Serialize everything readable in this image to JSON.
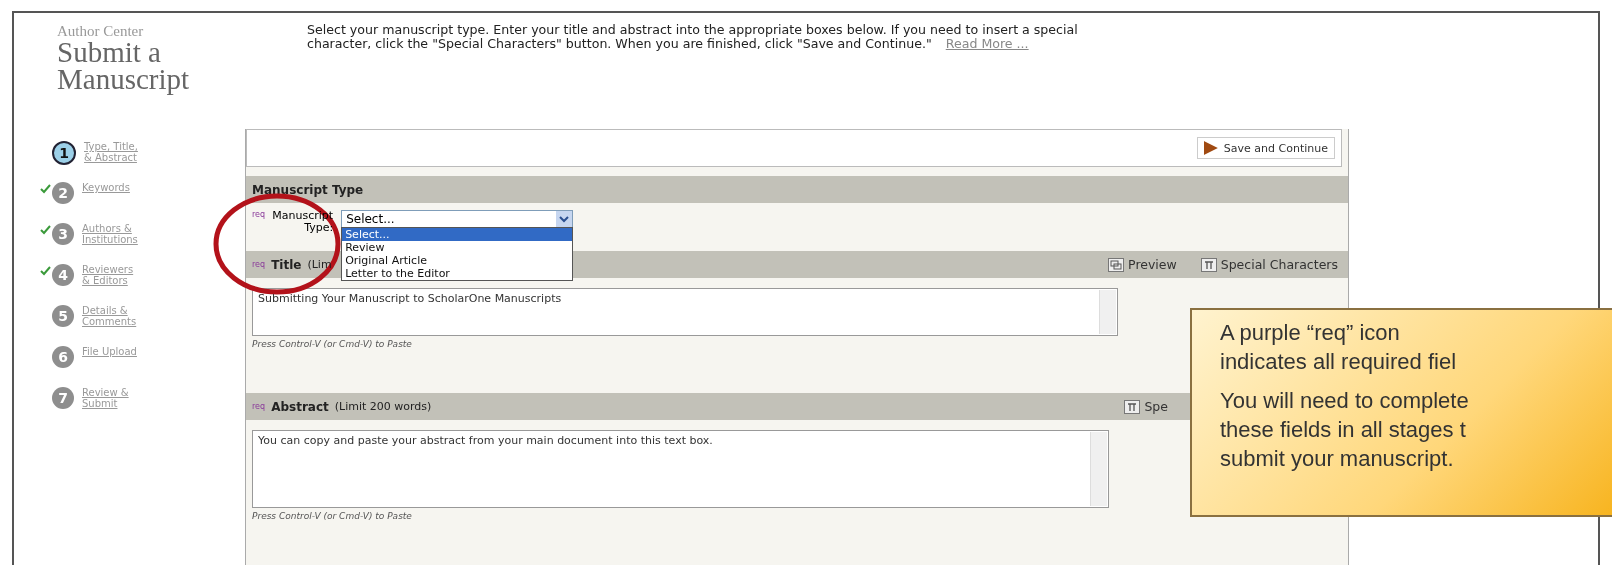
{
  "header": {
    "overline": "Author Center",
    "title_lines": [
      "Submit a",
      "Manuscript"
    ],
    "intro": "Select your manuscript type. Enter your title and abstract into the appropriate boxes below. If you need to insert a special character, click the \"Special Characters\" button. When you are finished, click \"Save and Continue.\"",
    "read_more": "Read More ..."
  },
  "steps": [
    {
      "number": "1",
      "lines": [
        "Type, Title,",
        "& Abstract"
      ],
      "current": true,
      "done": false
    },
    {
      "number": "2",
      "lines": [
        "Keywords"
      ],
      "current": false,
      "done": true
    },
    {
      "number": "3",
      "lines": [
        "Authors &",
        "Institutions"
      ],
      "current": false,
      "done": true
    },
    {
      "number": "4",
      "lines": [
        "Reviewers",
        "& Editors"
      ],
      "current": false,
      "done": true
    },
    {
      "number": "5",
      "lines": [
        "Details &",
        "Comments"
      ],
      "current": false,
      "done": false
    },
    {
      "number": "6",
      "lines": [
        "File Upload"
      ],
      "current": false,
      "done": false
    },
    {
      "number": "7",
      "lines": [
        "Review &",
        "Submit"
      ],
      "current": false,
      "done": false
    }
  ],
  "save_button": "Save and Continue",
  "manuscript_type": {
    "heading": "Manuscript Type",
    "req": "req",
    "label_lines": [
      "Manuscript",
      "Type:"
    ],
    "value": "Select...",
    "options": [
      {
        "label": "Select...",
        "selected": true
      },
      {
        "label": "Review",
        "selected": false
      },
      {
        "label": "Original Article",
        "selected": false
      },
      {
        "label": "Letter to the Editor",
        "selected": false
      }
    ]
  },
  "title": {
    "req": "req",
    "heading": "Title",
    "limit": "(Lim",
    "preview_button": "Preview",
    "special_button": "Special Characters",
    "value": "Submitting Your Manuscript to ScholarOne Manuscripts",
    "hint": "Press Control-V (or Cmd-V) to Paste"
  },
  "abstract": {
    "req": "req",
    "heading": "Abstract",
    "limit": "(Limit 200 words)",
    "special_button": "Spe",
    "value": "You can copy and paste your abstract from your main document into this text box.",
    "hint": "Press Control-V (or Cmd-V) to Paste"
  },
  "callout": {
    "paragraphs": [
      [
        "A purple “req” icon",
        "indicates all required fiel"
      ],
      [
        "You will need to complete",
        "these fields in all stages t",
        "submit your manuscript."
      ]
    ]
  }
}
